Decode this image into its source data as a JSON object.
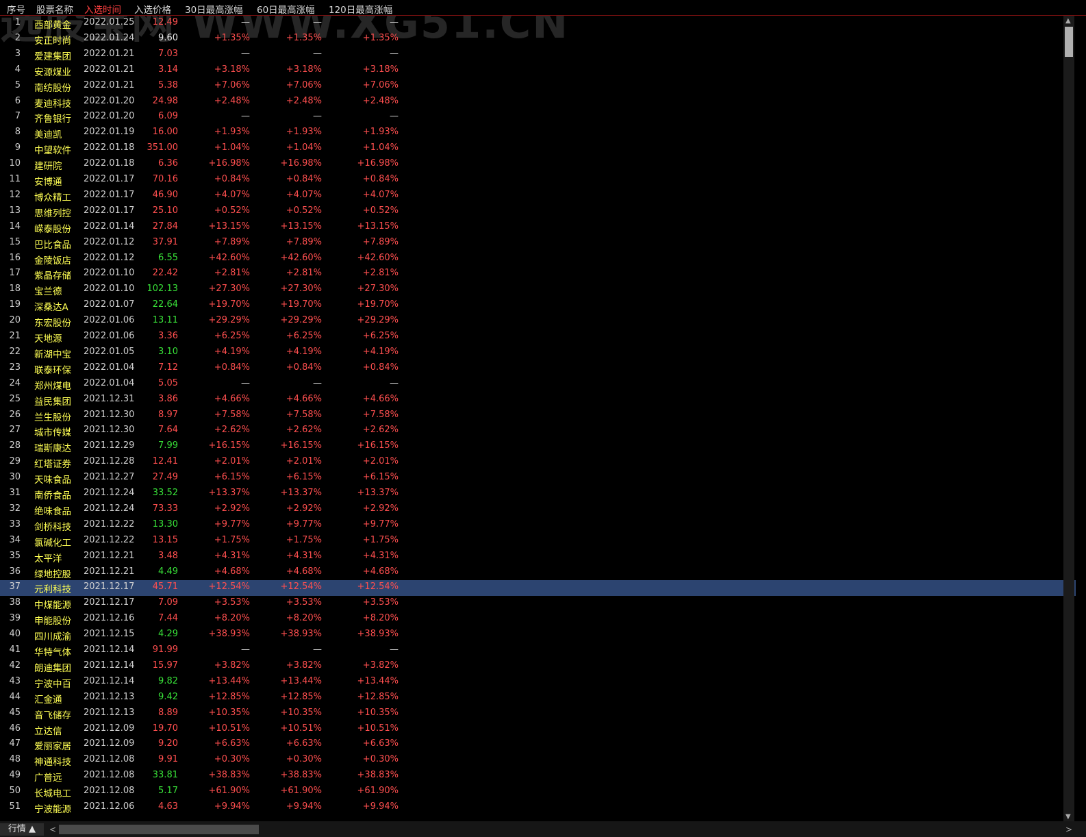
{
  "watermark": "选股宝网 WWW.XG51.CN",
  "header": {
    "columns": [
      "序号",
      "股票名称",
      "入选时间",
      "入选价格",
      "30日最高涨幅",
      "60日最高涨幅",
      "120日最高涨幅"
    ],
    "active_column": "入选时间"
  },
  "colors": {
    "background": "#000000",
    "name": "#ffff54",
    "up": "#ff4f4f",
    "down": "#38e038",
    "flat": "#e8e8e8",
    "selected_row": "#2c4470"
  },
  "selected_row_index": 37,
  "rows": [
    [
      "1",
      "西部黄金",
      "2022.01.25",
      "12.49",
      "—",
      "—",
      "—",
      "red"
    ],
    [
      "2",
      "安正时尚",
      "2022.01.24",
      "9.60",
      "+1.35%",
      "+1.35%",
      "+1.35%",
      "white"
    ],
    [
      "3",
      "爱建集团",
      "2022.01.21",
      "7.03",
      "—",
      "—",
      "—",
      "red"
    ],
    [
      "4",
      "安源煤业",
      "2022.01.21",
      "3.14",
      "+3.18%",
      "+3.18%",
      "+3.18%",
      "red"
    ],
    [
      "5",
      "南纺股份",
      "2022.01.21",
      "5.38",
      "+7.06%",
      "+7.06%",
      "+7.06%",
      "red"
    ],
    [
      "6",
      "麦迪科技",
      "2022.01.20",
      "24.98",
      "+2.48%",
      "+2.48%",
      "+2.48%",
      "red"
    ],
    [
      "7",
      "齐鲁银行",
      "2022.01.20",
      "6.09",
      "—",
      "—",
      "—",
      "red"
    ],
    [
      "8",
      "美迪凯",
      "2022.01.19",
      "16.00",
      "+1.93%",
      "+1.93%",
      "+1.93%",
      "red"
    ],
    [
      "9",
      "中望软件",
      "2022.01.18",
      "351.00",
      "+1.04%",
      "+1.04%",
      "+1.04%",
      "red"
    ],
    [
      "10",
      "建研院",
      "2022.01.18",
      "6.36",
      "+16.98%",
      "+16.98%",
      "+16.98%",
      "red"
    ],
    [
      "11",
      "安博通",
      "2022.01.17",
      "70.16",
      "+0.84%",
      "+0.84%",
      "+0.84%",
      "red"
    ],
    [
      "12",
      "博众精工",
      "2022.01.17",
      "46.90",
      "+4.07%",
      "+4.07%",
      "+4.07%",
      "red"
    ],
    [
      "13",
      "思维列控",
      "2022.01.17",
      "25.10",
      "+0.52%",
      "+0.52%",
      "+0.52%",
      "red"
    ],
    [
      "14",
      "嵘泰股份",
      "2022.01.14",
      "27.84",
      "+13.15%",
      "+13.15%",
      "+13.15%",
      "red"
    ],
    [
      "15",
      "巴比食品",
      "2022.01.12",
      "37.91",
      "+7.89%",
      "+7.89%",
      "+7.89%",
      "red"
    ],
    [
      "16",
      "金陵饭店",
      "2022.01.12",
      "6.55",
      "+42.60%",
      "+42.60%",
      "+42.60%",
      "green"
    ],
    [
      "17",
      "紫晶存储",
      "2022.01.10",
      "22.42",
      "+2.81%",
      "+2.81%",
      "+2.81%",
      "red"
    ],
    [
      "18",
      "宝兰德",
      "2022.01.10",
      "102.13",
      "+27.30%",
      "+27.30%",
      "+27.30%",
      "green"
    ],
    [
      "19",
      "深桑达A",
      "2022.01.07",
      "22.64",
      "+19.70%",
      "+19.70%",
      "+19.70%",
      "green"
    ],
    [
      "20",
      "东宏股份",
      "2022.01.06",
      "13.11",
      "+29.29%",
      "+29.29%",
      "+29.29%",
      "green"
    ],
    [
      "21",
      "天地源",
      "2022.01.06",
      "3.36",
      "+6.25%",
      "+6.25%",
      "+6.25%",
      "red"
    ],
    [
      "22",
      "新湖中宝",
      "2022.01.05",
      "3.10",
      "+4.19%",
      "+4.19%",
      "+4.19%",
      "green"
    ],
    [
      "23",
      "联泰环保",
      "2022.01.04",
      "7.12",
      "+0.84%",
      "+0.84%",
      "+0.84%",
      "red"
    ],
    [
      "24",
      "郑州煤电",
      "2022.01.04",
      "5.05",
      "—",
      "—",
      "—",
      "red"
    ],
    [
      "25",
      "益民集团",
      "2021.12.31",
      "3.86",
      "+4.66%",
      "+4.66%",
      "+4.66%",
      "red"
    ],
    [
      "26",
      "兰生股份",
      "2021.12.30",
      "8.97",
      "+7.58%",
      "+7.58%",
      "+7.58%",
      "red"
    ],
    [
      "27",
      "城市传媒",
      "2021.12.30",
      "7.64",
      "+2.62%",
      "+2.62%",
      "+2.62%",
      "red"
    ],
    [
      "28",
      "瑞斯康达",
      "2021.12.29",
      "7.99",
      "+16.15%",
      "+16.15%",
      "+16.15%",
      "green"
    ],
    [
      "29",
      "红塔证券",
      "2021.12.28",
      "12.41",
      "+2.01%",
      "+2.01%",
      "+2.01%",
      "red"
    ],
    [
      "30",
      "天味食品",
      "2021.12.27",
      "27.49",
      "+6.15%",
      "+6.15%",
      "+6.15%",
      "red"
    ],
    [
      "31",
      "南侨食品",
      "2021.12.24",
      "33.52",
      "+13.37%",
      "+13.37%",
      "+13.37%",
      "green"
    ],
    [
      "32",
      "绝味食品",
      "2021.12.24",
      "73.33",
      "+2.92%",
      "+2.92%",
      "+2.92%",
      "red"
    ],
    [
      "33",
      "剑桥科技",
      "2021.12.22",
      "13.30",
      "+9.77%",
      "+9.77%",
      "+9.77%",
      "green"
    ],
    [
      "34",
      "氯碱化工",
      "2021.12.22",
      "13.15",
      "+1.75%",
      "+1.75%",
      "+1.75%",
      "red"
    ],
    [
      "35",
      "太平洋",
      "2021.12.21",
      "3.48",
      "+4.31%",
      "+4.31%",
      "+4.31%",
      "red"
    ],
    [
      "36",
      "绿地控股",
      "2021.12.21",
      "4.49",
      "+4.68%",
      "+4.68%",
      "+4.68%",
      "green"
    ],
    [
      "37",
      "元利科技",
      "2021.12.17",
      "45.71",
      "+12.54%",
      "+12.54%",
      "+12.54%",
      "red"
    ],
    [
      "38",
      "中煤能源",
      "2021.12.17",
      "7.09",
      "+3.53%",
      "+3.53%",
      "+3.53%",
      "red"
    ],
    [
      "39",
      "申能股份",
      "2021.12.16",
      "7.44",
      "+8.20%",
      "+8.20%",
      "+8.20%",
      "red"
    ],
    [
      "40",
      "四川成渝",
      "2021.12.15",
      "4.29",
      "+38.93%",
      "+38.93%",
      "+38.93%",
      "green"
    ],
    [
      "41",
      "华特气体",
      "2021.12.14",
      "91.99",
      "—",
      "—",
      "—",
      "red"
    ],
    [
      "42",
      "朗迪集团",
      "2021.12.14",
      "15.97",
      "+3.82%",
      "+3.82%",
      "+3.82%",
      "red"
    ],
    [
      "43",
      "宁波中百",
      "2021.12.14",
      "9.82",
      "+13.44%",
      "+13.44%",
      "+13.44%",
      "green"
    ],
    [
      "44",
      "汇金通",
      "2021.12.13",
      "9.42",
      "+12.85%",
      "+12.85%",
      "+12.85%",
      "green"
    ],
    [
      "45",
      "音飞储存",
      "2021.12.13",
      "8.89",
      "+10.35%",
      "+10.35%",
      "+10.35%",
      "red"
    ],
    [
      "46",
      "立达信",
      "2021.12.09",
      "19.70",
      "+10.51%",
      "+10.51%",
      "+10.51%",
      "red"
    ],
    [
      "47",
      "爱丽家居",
      "2021.12.09",
      "9.20",
      "+6.63%",
      "+6.63%",
      "+6.63%",
      "red"
    ],
    [
      "48",
      "神通科技",
      "2021.12.08",
      "9.91",
      "+0.30%",
      "+0.30%",
      "+0.30%",
      "red"
    ],
    [
      "49",
      "广普远",
      "2021.12.08",
      "33.81",
      "+38.83%",
      "+38.83%",
      "+38.83%",
      "green"
    ],
    [
      "50",
      "长城电工",
      "2021.12.08",
      "5.17",
      "+61.90%",
      "+61.90%",
      "+61.90%",
      "green"
    ],
    [
      "51",
      "宁波能源",
      "2021.12.06",
      "4.63",
      "+9.94%",
      "+9.94%",
      "+9.94%",
      "red"
    ]
  ],
  "bottom": {
    "tab_label": "行情 ▲",
    "left_arrow": "<"
  },
  "scrollbar": {
    "up_arrow": "▲",
    "down_arrow": "▼",
    "right_arrow": ">"
  }
}
